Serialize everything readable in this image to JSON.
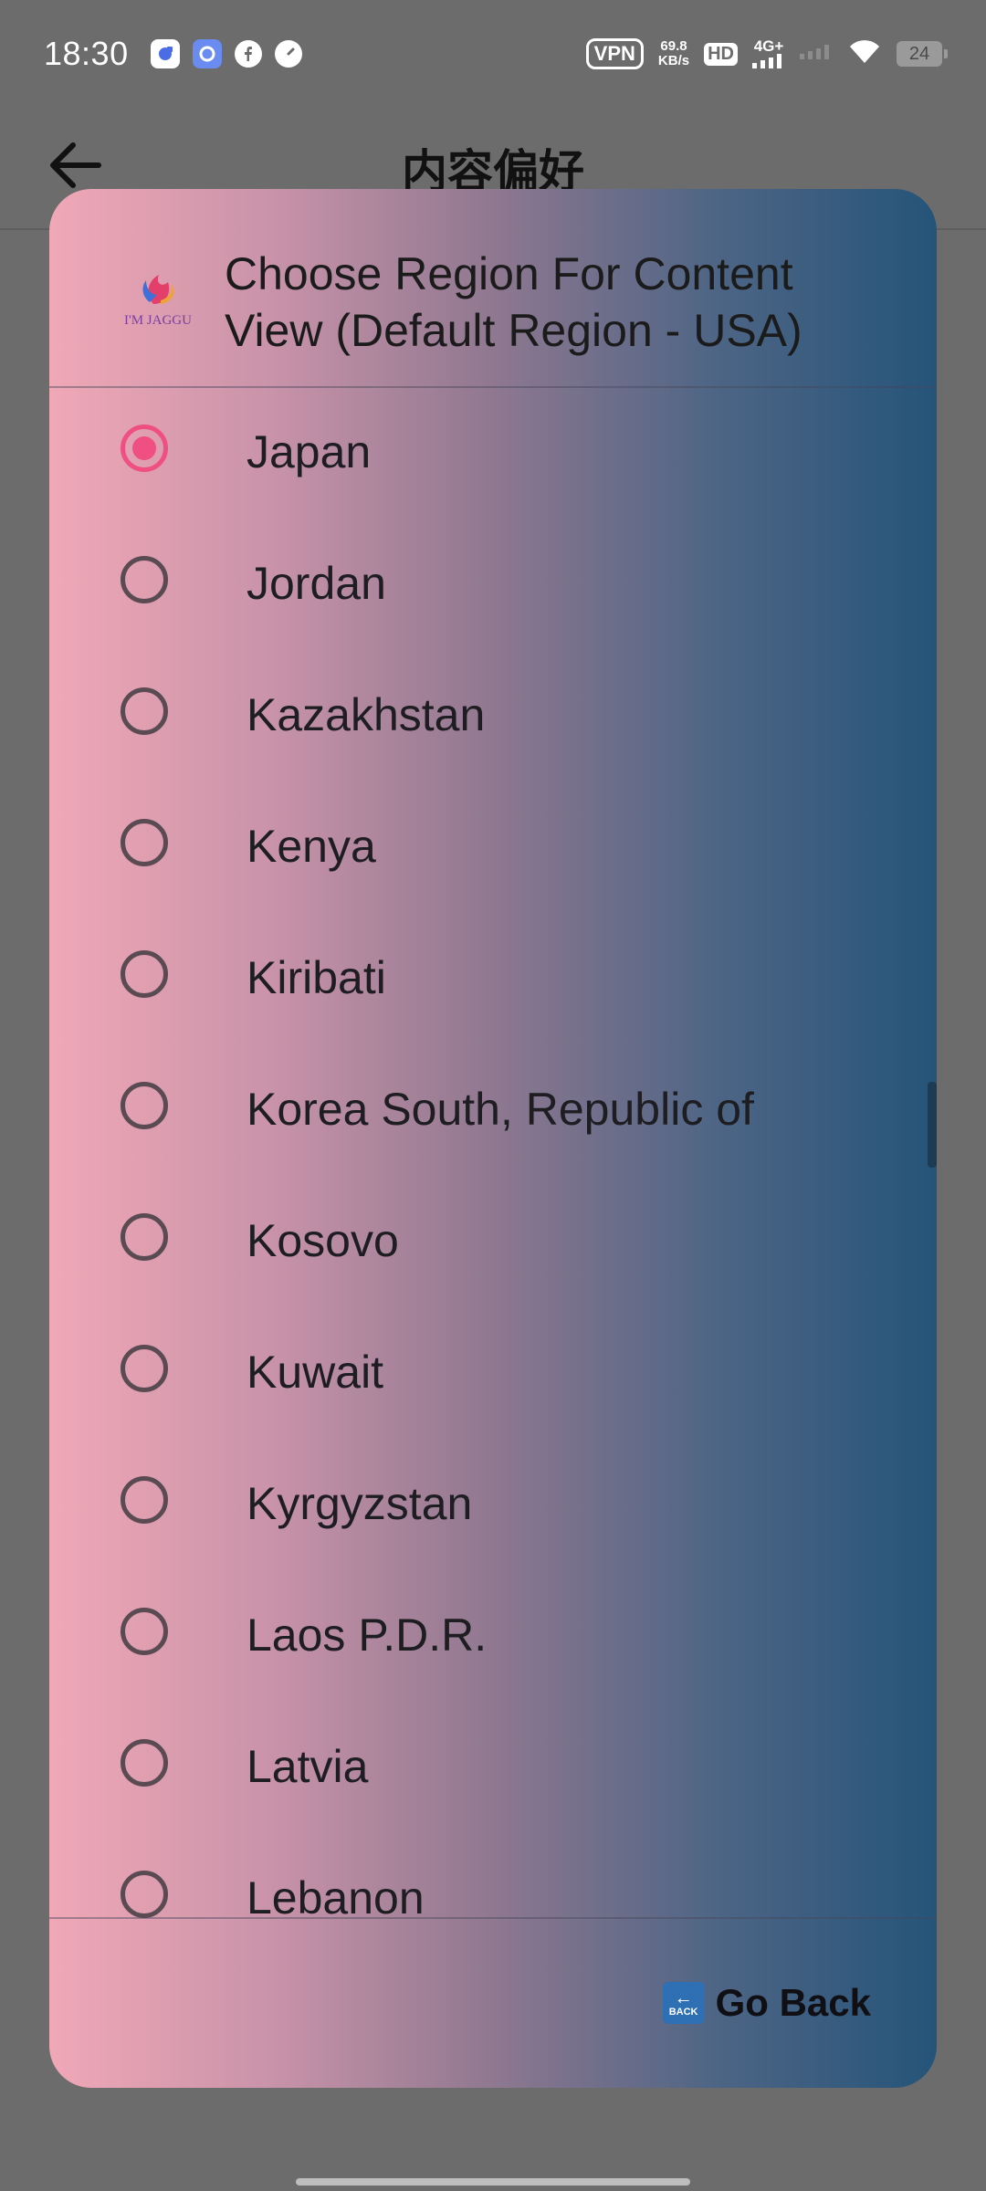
{
  "status_bar": {
    "time": "18:30",
    "vpn": "VPN",
    "speed_value": "69.8",
    "speed_unit": "KB/s",
    "hd": "HD",
    "network": "4G+",
    "battery": "24"
  },
  "header": {
    "title": "内容偏好"
  },
  "dialog": {
    "logo_text": "I'M JAGGU",
    "title": "Choose Region For Content View (Default Region - USA)",
    "selected_region": "Japan",
    "regions": [
      {
        "label": "Japan",
        "checked": true
      },
      {
        "label": "Jordan",
        "checked": false
      },
      {
        "label": "Kazakhstan",
        "checked": false
      },
      {
        "label": "Kenya",
        "checked": false
      },
      {
        "label": "Kiribati",
        "checked": false
      },
      {
        "label": "Korea South, Republic of",
        "checked": false
      },
      {
        "label": "Kosovo",
        "checked": false
      },
      {
        "label": "Kuwait",
        "checked": false
      },
      {
        "label": "Kyrgyzstan",
        "checked": false
      },
      {
        "label": "Laos P.D.R.",
        "checked": false
      },
      {
        "label": "Latvia",
        "checked": false
      },
      {
        "label": "Lebanon",
        "checked": false
      }
    ],
    "go_back_emoji_text": "BACK",
    "go_back_label": "Go Back"
  },
  "colors": {
    "accent_radio": "#ef4f83",
    "gradient_left": "#f0a8b7",
    "gradient_right": "#255479",
    "overlay": "#6c6c6c"
  },
  "icons": {
    "back": "arrow-left-icon",
    "radio_checked": "radio-checked-icon",
    "radio_unchecked": "radio-unchecked-icon",
    "go_back": "back-arrow-emoji-icon"
  }
}
